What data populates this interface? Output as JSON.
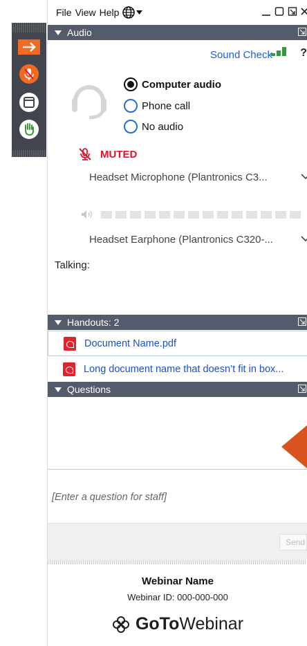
{
  "menu": {
    "file": "File",
    "view": "View",
    "help": "Help"
  },
  "audio": {
    "header": "Audio",
    "sound_check": "Sound Check",
    "options": [
      {
        "label": "Computer audio",
        "selected": true
      },
      {
        "label": "Phone call",
        "selected": false
      },
      {
        "label": "No audio",
        "selected": false
      }
    ],
    "muted_label": "MUTED",
    "microphone": "Headset Microphone (Plantronics C3...",
    "speaker": "Headset Earphone (Plantronics C320-...",
    "talking_label": "Talking:"
  },
  "handouts": {
    "header": "Handouts: 2",
    "items": [
      {
        "name": "Document Name.pdf"
      },
      {
        "name": "Long document name that doesn’t fit in box..."
      }
    ]
  },
  "questions": {
    "header": "Questions",
    "placeholder": "[Enter a question for staff]",
    "send_label": "Send"
  },
  "webinar": {
    "name": "Webinar Name",
    "id": "Webinar ID: 000-000-000"
  },
  "brand": {
    "part1": "GoTo",
    "part2": "Webinar"
  },
  "colors": {
    "accent": "#1a5ce0",
    "header": "#545b6a",
    "muted": "#e3122b",
    "orange": "#f26a21",
    "mic_active": "#f26a21"
  }
}
